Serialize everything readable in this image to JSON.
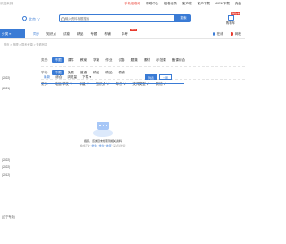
{
  "topbar": {
    "welcome": "欢迎来到",
    "links": [
      "手机组卷网",
      "帮助中心",
      "组卷记录",
      "客户端",
      "客户下载",
      "AIFM下载",
      "充值"
    ]
  },
  "header": {
    "location": "北京",
    "search_placeholder": "输入资料标题搜索",
    "search_button": "搜索",
    "cart_badge": "购物车",
    "cart_label": "购物车"
  },
  "nav": {
    "category": "分类 ≡",
    "tabs": [
      {
        "label": "同步",
        "active": true
      },
      {
        "label": "知识点",
        "active": false
      },
      {
        "label": "试卷",
        "active": false
      },
      {
        "label": "精品",
        "active": false
      },
      {
        "label": "专题",
        "active": false
      },
      {
        "label": "教辅",
        "active": false
      },
      {
        "label": "中考",
        "active": false,
        "hot": "HOT"
      },
      {
        "label": "",
        "active": false
      }
    ],
    "right": [
      "在线",
      "网校"
    ]
  },
  "breadcrumb": "首页 > 物理 > 同步资源 > 查看列表",
  "sidebar": {
    "items": [
      "(2022)",
      "(2021)",
      "(2022)",
      "(2022)",
      "(2012)",
      "(辽宁专版)"
    ]
  },
  "filters": {
    "type_label": "类型:",
    "type_options": [
      "不限",
      "课件",
      "教案",
      "学案",
      "作业",
      "试卷",
      "题集",
      "素材",
      "示范课",
      "备课综合"
    ],
    "scope_label": "学段:",
    "scope_options": [
      "不限",
      "免费",
      "普通",
      "精品",
      "精品",
      "教辅"
    ],
    "more_label": "更多:",
    "more_options": [
      "地区/学校 ∨",
      "年级 ∨",
      "知识点 ∨",
      "年份 ∨",
      "文件类型 ∨",
      "其他 ∨"
    ]
  },
  "sort": {
    "options": [
      "最新",
      "综合",
      "浏览量",
      "下载 ▾"
    ],
    "view_buttons": [
      "列表",
      "大图"
    ]
  },
  "empty": {
    "message": "抱歉，该类目未检索到相关资料",
    "suggest_prefix": "换成正文",
    "suggest_links": [
      "学生",
      "学生",
      "地区"
    ],
    "suggest_suffix": "等试试搜索"
  }
}
